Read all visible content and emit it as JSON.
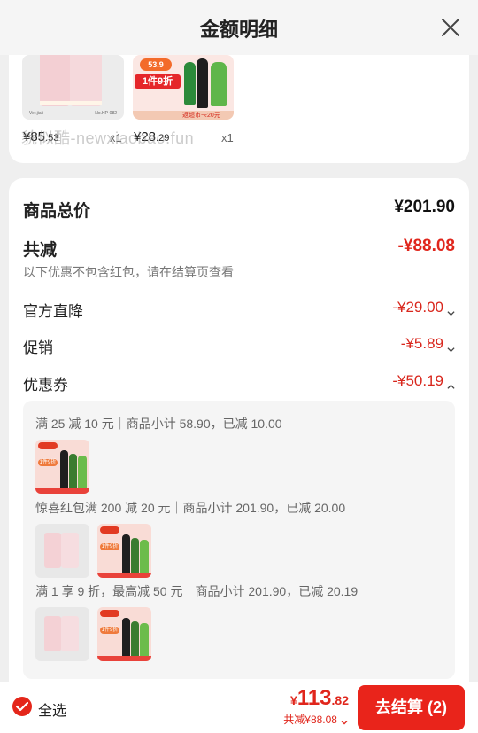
{
  "header": {
    "title": "金额明细",
    "close_icon": "close-icon"
  },
  "top_products": {
    "watermark": "貌似酷-newxiaobao.fun",
    "items": [
      {
        "price_int": "¥85",
        "price_dec": ".53",
        "qty": "x1",
        "name_tag": "Ver.jiali",
        "sku_tag": "No.HP-082"
      },
      {
        "price_int": "¥28",
        "price_dec": ".29",
        "qty": "x1",
        "badge": "53.9",
        "offer": "1件9折",
        "strip": "返超市卡20元"
      }
    ]
  },
  "summary": {
    "total_label": "商品总价",
    "total_value": "¥201.90",
    "reduce_label": "共减",
    "reduce_value": "-¥88.08",
    "reduce_note": "以下优惠不包含红包，请在结算页查看",
    "lines": [
      {
        "label": "官方直降",
        "value": "-¥29.00",
        "chevron": "chevron-down-icon"
      },
      {
        "label": "促销",
        "value": "-¥5.89",
        "chevron": "chevron-down-icon"
      },
      {
        "label": "优惠券",
        "value": "-¥50.19",
        "chevron": "chevron-up-icon"
      }
    ]
  },
  "coupons": [
    {
      "text": "满 25 减 10 元｜商品小计 58.90，已减 10.00",
      "products": [
        "oil"
      ]
    },
    {
      "text": "惊喜红包满 200 减 20 元｜商品小计 201.90，已减 20.00",
      "products": [
        "pajama",
        "oil"
      ]
    },
    {
      "text": "满 1 享 9 折，最高减 50 元｜商品小计 201.90，已减 20.19",
      "products": [
        "pajama",
        "oil"
      ]
    }
  ],
  "mini_labels": {
    "oil_offer": "1件9折"
  },
  "bottom_bar": {
    "select_all": "全选",
    "currency": "¥",
    "total_int": "113",
    "total_dec": ".82",
    "saved": "共减¥88.08",
    "pay_button": "去结算 (2)"
  },
  "colors": {
    "accent_red": "#e9241b",
    "discount_red": "#d9271d"
  }
}
